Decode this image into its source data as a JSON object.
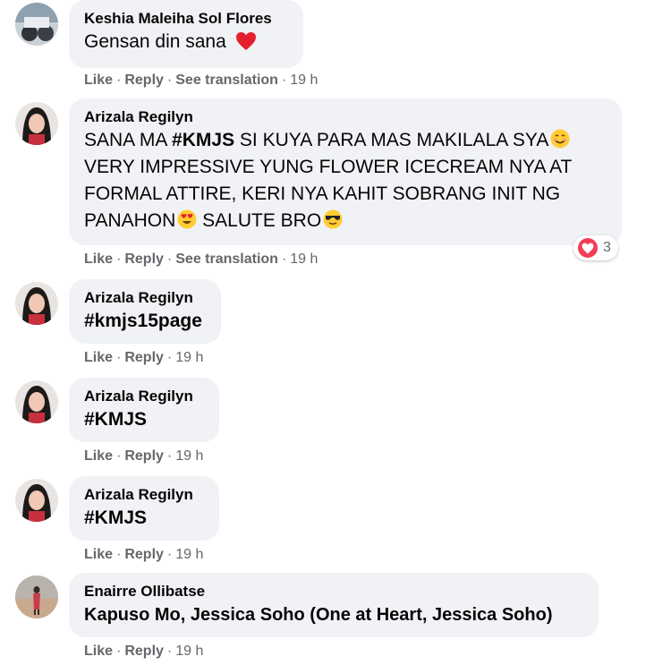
{
  "actions": {
    "like": "Like",
    "reply": "Reply",
    "see_translation": "See translation",
    "separator": "·"
  },
  "comments": [
    {
      "author": "Keshia Maleiha Sol Flores",
      "text_lines": [
        "Gensan din sana"
      ],
      "emoji": "red-heart",
      "time": "19 h"
    },
    {
      "author": "Arizala Regilyn",
      "text_lines": [
        "SANA MA ",
        "#KMJS",
        " SI KUYA PARA MAS MAKILALA SYA",
        "VERY IMPRESSIVE YUNG FLOWER ICECREAM NYA AT",
        "FORMAL ATTIRE, KERI NYA KAHIT SOBRANG INIT NG",
        "PANAHON",
        " SALUTE BRO"
      ],
      "time": "19 h",
      "reaction_count": "3"
    },
    {
      "author": "Arizala Regilyn",
      "text_lines": [
        "#kmjs15page"
      ],
      "time": "19 h"
    },
    {
      "author": "Arizala Regilyn",
      "text_lines": [
        "#KMJS"
      ],
      "time": "19 h"
    },
    {
      "author": "Arizala Regilyn",
      "text_lines": [
        "#KMJS"
      ],
      "time": "19 h"
    },
    {
      "author": "Enairre Ollibatse",
      "text_lines": [
        "Kapuso Mo, Jessica Soho (One at Heart, Jessica Soho)"
      ],
      "time": "19 h"
    }
  ],
  "colors": {
    "bubble": "#f0f2f5",
    "meta": "#65676b",
    "heart": "#f33e58"
  }
}
